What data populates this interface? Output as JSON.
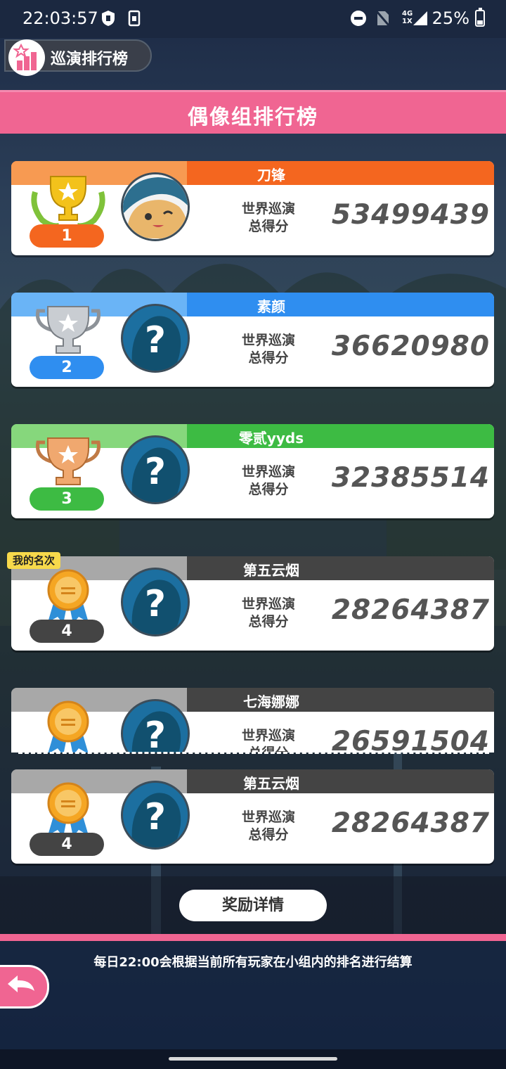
{
  "status_bar": {
    "time": "22:03:57",
    "network_top": "4G",
    "network_bottom": "1X",
    "battery": "25%"
  },
  "tour_tab": {
    "label": "巡演排行榜"
  },
  "header": {
    "title": "偶像组排行榜"
  },
  "score_label": {
    "line1": "世界巡演",
    "line2": "总得分"
  },
  "colors": {
    "first": "#f4661f",
    "second": "#2f8ef0",
    "third": "#3dbb43",
    "other": "#444444",
    "pink": "#f06592"
  },
  "rows": [
    {
      "rank": "1",
      "name": "刀锋",
      "score": "53499439",
      "avatar": "custom-avatar",
      "badge": "gold-trophy-icon"
    },
    {
      "rank": "2",
      "name": "素颜",
      "score": "36620980",
      "avatar": "default-avatar",
      "badge": "silver-trophy-icon"
    },
    {
      "rank": "3",
      "name": "零贰yyds",
      "score": "32385514",
      "avatar": "default-avatar",
      "badge": "bronze-trophy-icon"
    },
    {
      "rank": "4",
      "name": "第五云烟",
      "score": "28264387",
      "avatar": "default-avatar",
      "badge": "medal-icon",
      "tag": "我的名次"
    },
    {
      "rank": "",
      "name": "七海娜娜",
      "score": "26591504",
      "avatar": "default-avatar",
      "badge": "medal-icon"
    }
  ],
  "my_row": {
    "rank": "4",
    "name": "第五云烟",
    "score": "28264387"
  },
  "reward_button": "奖励详情",
  "settle_note": "每日22:00会根据当前所有玩家在小组内的排名进行结算"
}
